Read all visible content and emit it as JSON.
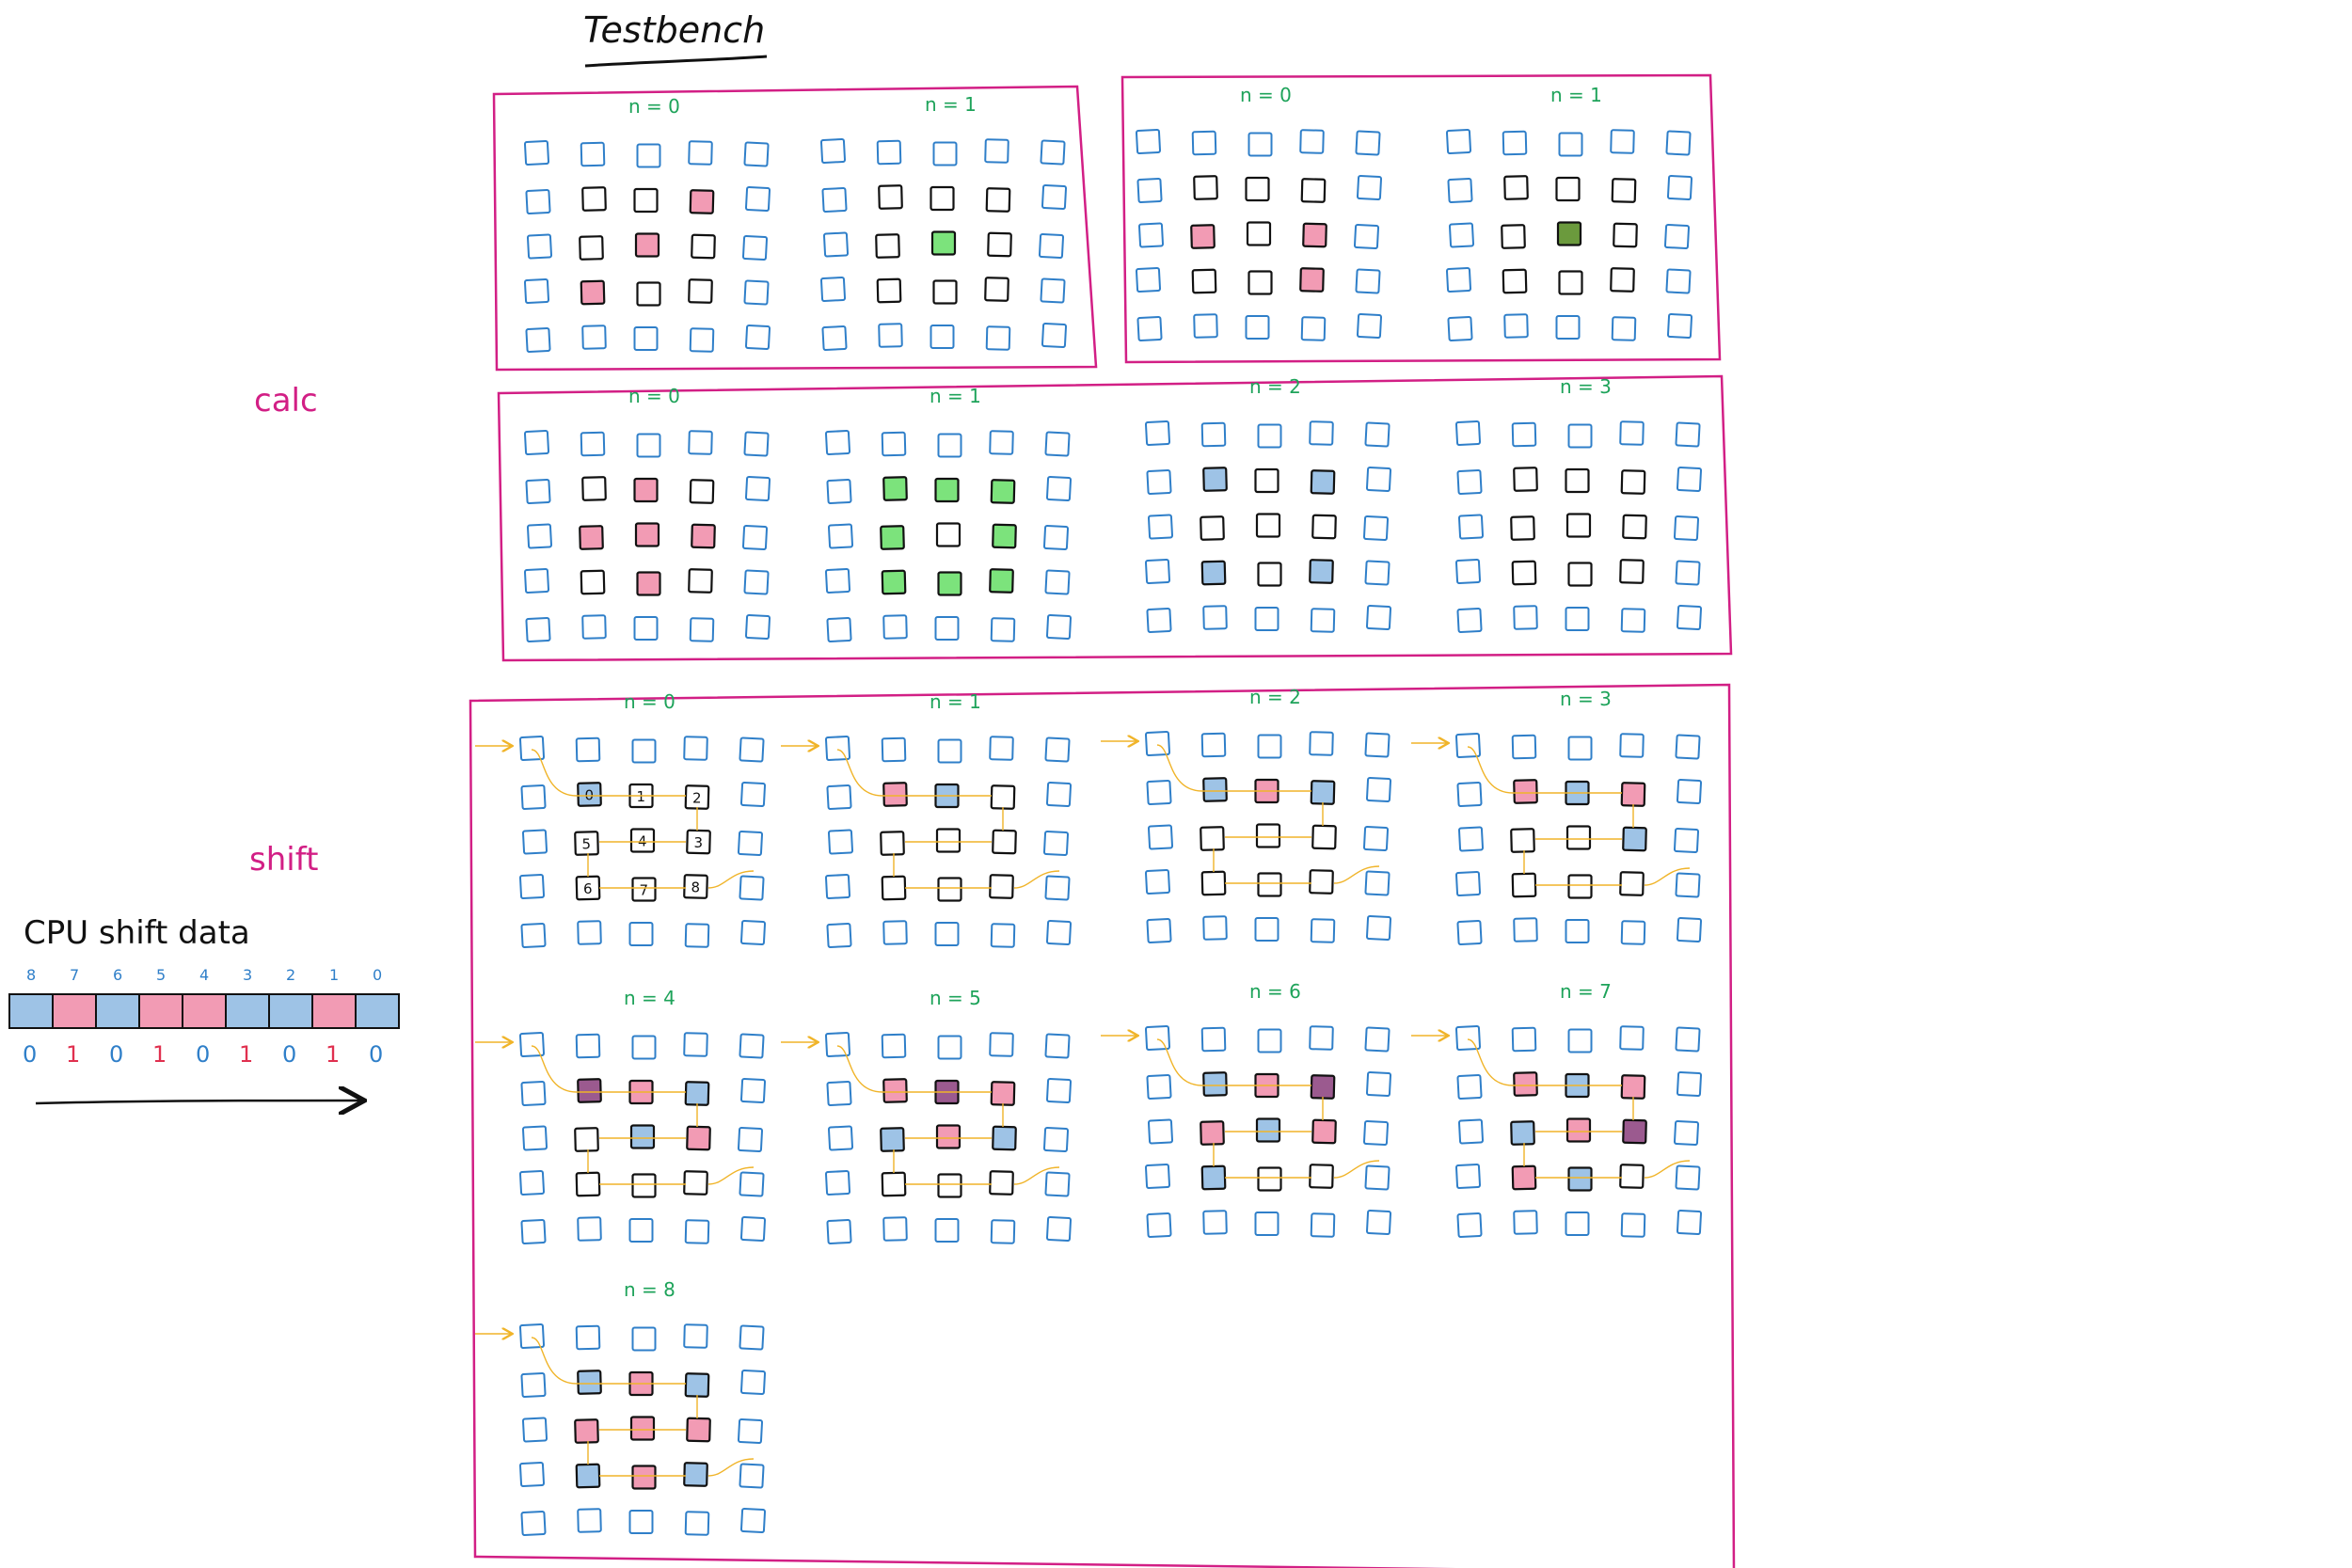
{
  "title": "Testbench",
  "labels": {
    "calc": "calc",
    "shift": "shift",
    "cpu": "CPU shift data"
  },
  "colors": {
    "border": "#d21f85",
    "blue": "#2f7fc9",
    "ink": "#111111",
    "pink": "#f29bb4",
    "lightblue": "#9ec3e6",
    "green": "#7ce37c",
    "darkgreen": "#6b9a3d",
    "purple": "#9b5a8f",
    "arrow": "#f0b429",
    "nlabel": "#1ea35a",
    "red": "#e0304f"
  },
  "panels": [
    {
      "name": "testbench-a",
      "grids": [
        {
          "label": "n = 0",
          "cells": {
            "1,3": "pink",
            "2,2": "pink",
            "3,1": "pink"
          }
        },
        {
          "label": "n = 1",
          "cells": {
            "2,2": "green"
          }
        }
      ]
    },
    {
      "name": "testbench-b",
      "grids": [
        {
          "label": "n = 0",
          "cells": {
            "2,1": "pink",
            "2,3": "pink",
            "3,3": "pink"
          }
        },
        {
          "label": "n = 1",
          "cells": {
            "2,2": "darkgreen"
          }
        }
      ]
    },
    {
      "name": "calc",
      "grids": [
        {
          "label": "n = 0",
          "cells": {
            "1,2": "pink",
            "2,1": "pink",
            "2,2": "pink",
            "2,3": "pink",
            "3,2": "pink"
          }
        },
        {
          "label": "n = 1",
          "cells": {
            "1,1": "green",
            "1,2": "green",
            "1,3": "green",
            "2,1": "green",
            "2,3": "green",
            "3,1": "green",
            "3,2": "green",
            "3,3": "green"
          }
        },
        {
          "label": "n = 2",
          "cells": {
            "1,1": "lightblue",
            "1,3": "lightblue",
            "3,1": "lightblue",
            "3,3": "lightblue"
          }
        },
        {
          "label": "n = 3",
          "cells": {}
        }
      ]
    },
    {
      "name": "shift",
      "grids": [
        {
          "label": "n = 0",
          "cells": {
            "1,1": "lightblue"
          },
          "numbers": [
            "0",
            "1",
            "2",
            "3",
            "4",
            "5",
            "6",
            "7",
            "8"
          ]
        },
        {
          "label": "n = 1",
          "cells": {
            "1,1": "pink",
            "1,2": "lightblue"
          }
        },
        {
          "label": "n = 2",
          "cells": {
            "1,1": "lightblue",
            "1,2": "pink",
            "1,3": "lightblue"
          }
        },
        {
          "label": "n = 3",
          "cells": {
            "1,1": "pink",
            "1,2": "lightblue",
            "1,3": "pink",
            "2,3": "lightblue"
          }
        },
        {
          "label": "n = 4",
          "cells": {
            "1,1": "purple",
            "1,2": "pink",
            "1,3": "lightblue",
            "2,3": "pink",
            "2,2": "lightblue"
          }
        },
        {
          "label": "n = 5",
          "cells": {
            "1,1": "pink",
            "1,2": "purple",
            "1,3": "pink",
            "2,3": "lightblue",
            "2,2": "pink",
            "2,1": "lightblue"
          }
        },
        {
          "label": "n = 6",
          "cells": {
            "1,1": "lightblue",
            "1,2": "pink",
            "1,3": "purple",
            "2,3": "pink",
            "2,2": "lightblue",
            "2,1": "pink",
            "3,1": "lightblue"
          }
        },
        {
          "label": "n = 7",
          "cells": {
            "1,1": "pink",
            "1,2": "lightblue",
            "1,3": "pink",
            "2,3": "purple",
            "2,2": "pink",
            "2,1": "lightblue",
            "3,1": "pink",
            "3,2": "lightblue"
          }
        },
        {
          "label": "n = 8",
          "cells": {
            "1,1": "lightblue",
            "1,2": "pink",
            "1,3": "lightblue",
            "2,3": "pink",
            "2,2": "pink",
            "2,1": "pink",
            "3,1": "lightblue",
            "3,2": "pink",
            "3,3": "lightblue"
          }
        }
      ]
    }
  ],
  "cpu": {
    "indices": [
      "8",
      "7",
      "6",
      "5",
      "4",
      "3",
      "2",
      "1",
      "0"
    ],
    "bits": [
      "0",
      "1",
      "0",
      "1",
      "0",
      "1",
      "0",
      "1",
      "0"
    ],
    "fills": [
      "lightblue",
      "pink",
      "lightblue",
      "pink",
      "pink",
      "lightblue",
      "lightblue",
      "pink",
      "lightblue"
    ]
  }
}
